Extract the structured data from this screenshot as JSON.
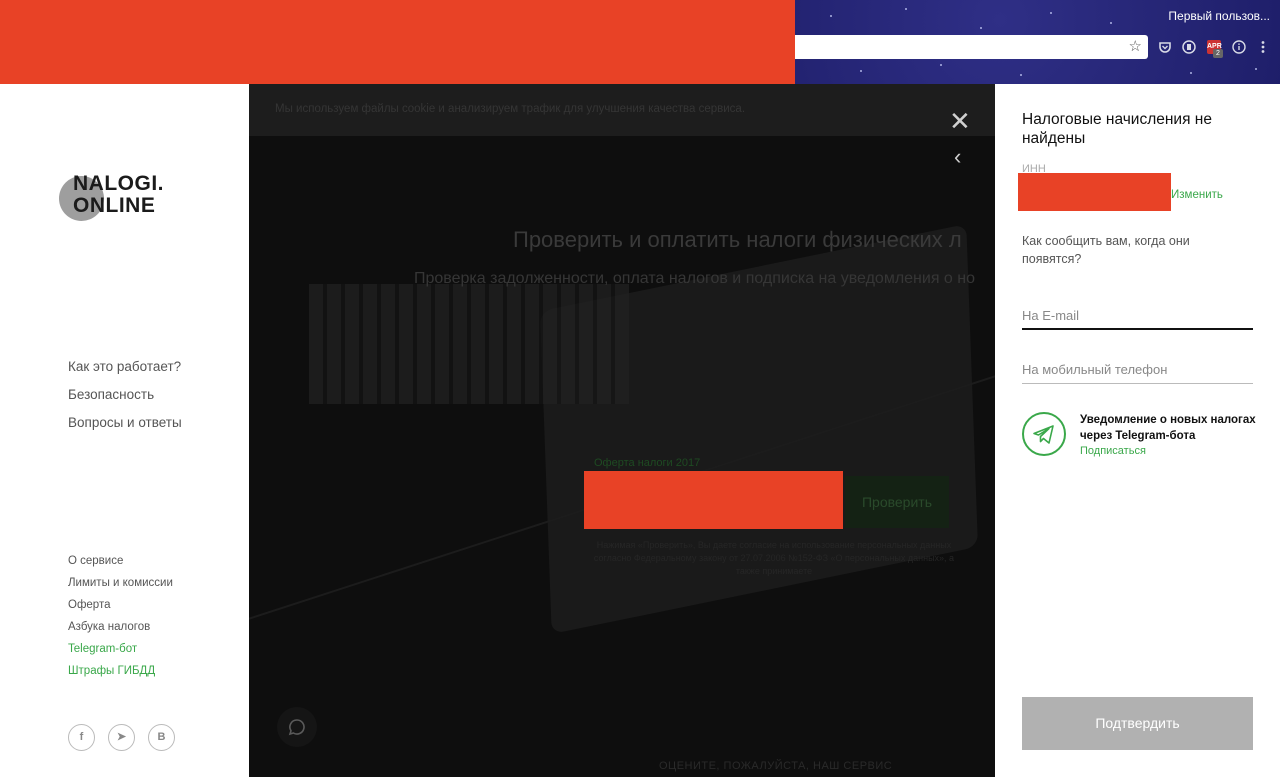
{
  "browser": {
    "profile_name": "Первый пользов...",
    "extension_badge": "2",
    "extension_label": "APR",
    "icons": [
      "bookmark-star-icon",
      "pocket-icon",
      "extension-icon",
      "apr-extension-icon",
      "info-icon",
      "menu-dots-icon"
    ]
  },
  "sidebar": {
    "logo_line1": "NALOGI.",
    "logo_line2": "ONLINE",
    "main_nav": [
      "Как это работает?",
      "Безопасность",
      "Вопросы и ответы"
    ],
    "footer_nav": [
      "О сервисе",
      "Лимиты и комиссии",
      "Оферта",
      "Азбука налогов",
      "Telegram-бот",
      "Штрафы ГИБДД"
    ],
    "social": [
      "f",
      "➤",
      "B"
    ]
  },
  "overlay": {
    "cookie_text": "Мы используем файлы cookie и анализируем трафик для улучшения качества сервиса.",
    "hero_title": "Проверить и оплатить налоги физических л",
    "hero_subtitle": "Проверка задолженности, оплата налогов и подписка на уведомления о но",
    "oferta_link": "Оферта налоги 2017",
    "check_button": "Проверить",
    "disclaimer": "Нажимая «Проверить», Вы даете согласие на использование персональных данных согласно Федеральному закону от 27.07.2006 №152-ФЗ «О персональных данных», а также принимаете",
    "rate_text": "ОЦЕНИТЕ, ПОЖАЛУЙСТА, НАШ СЕРВИС"
  },
  "panel": {
    "title": "Налоговые начисления не найдены",
    "inn_label": "ИНН",
    "change_link": "Изменить",
    "ask_text": "Как сообщить вам, когда они появятся?",
    "email_placeholder": "На E-mail",
    "phone_placeholder": "На мобильный телефон",
    "telegram_title": "Уведомление о новых налогах через Telegram-бота",
    "telegram_subscribe": "Подписаться",
    "confirm_button": "Подтвердить"
  },
  "colors": {
    "accent_green": "#3aa84a",
    "redaction": "#e84226",
    "confirm_disabled": "#b1b1b1"
  }
}
